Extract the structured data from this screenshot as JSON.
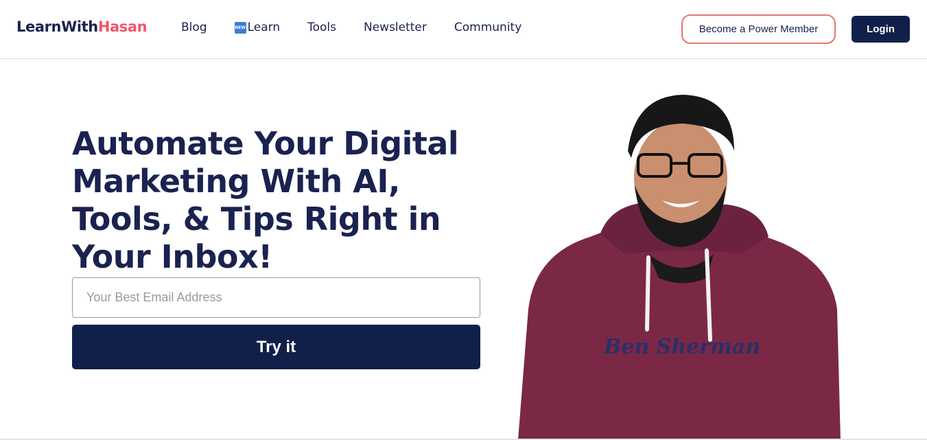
{
  "header": {
    "logo": {
      "part1": "LearnWith",
      "part2": "Hasan"
    },
    "nav": [
      {
        "label": "Blog"
      },
      {
        "label": "Learn",
        "badge": "NEW"
      },
      {
        "label": "Tools"
      },
      {
        "label": "Newsletter"
      },
      {
        "label": "Community"
      }
    ],
    "power_member_label": "Become a Power Member",
    "login_label": "Login"
  },
  "hero": {
    "headline": "Automate Your Digital Marketing With AI, Tools, & Tips Right in Your Inbox!",
    "email_placeholder": "Your Best Email Address",
    "email_value": "",
    "cta_label": "Try it",
    "shirt_text": "Ben Sherman"
  },
  "colors": {
    "brand_navy": "#10204a",
    "text_navy": "#1a2250",
    "accent_pink": "#f0566b",
    "button_outline": "#e5776a",
    "hoodie": "#7a2845"
  },
  "icons": {
    "new_badge": "new-badge-icon"
  }
}
